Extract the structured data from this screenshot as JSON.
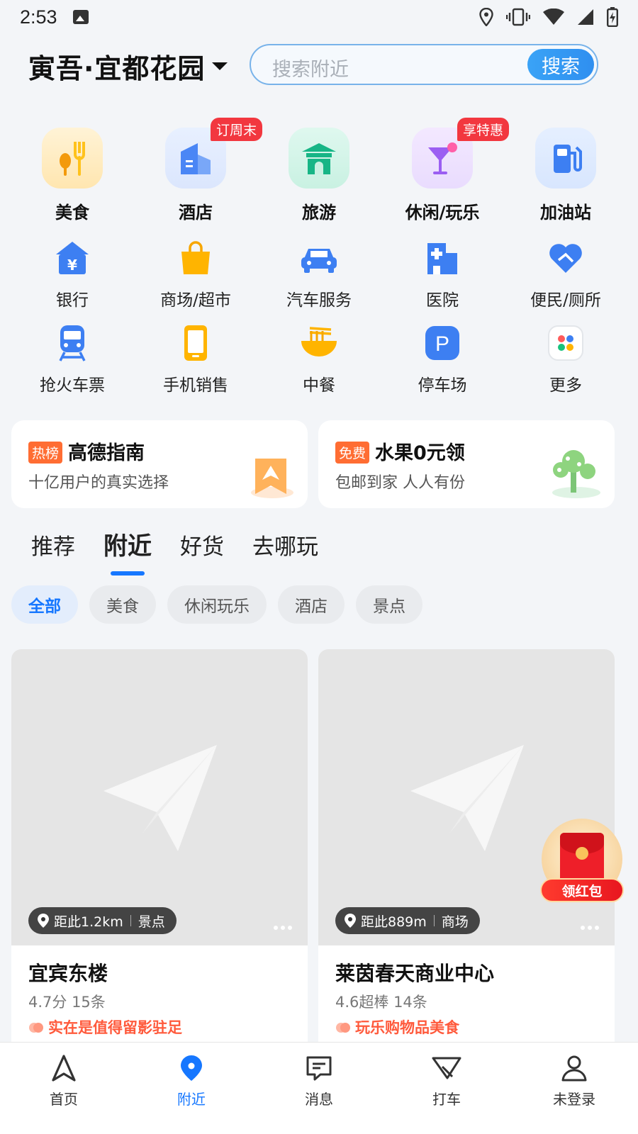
{
  "status_bar": {
    "time": "2:53"
  },
  "header": {
    "location": "寅吾·宜都花园",
    "search_placeholder": "搜索附近",
    "search_button": "搜索"
  },
  "main_categories": [
    {
      "label": "美食",
      "icon": "fork-spoon-icon"
    },
    {
      "label": "酒店",
      "icon": "hotel-building-icon",
      "badge": "订周末"
    },
    {
      "label": "旅游",
      "icon": "pavilion-icon"
    },
    {
      "label": "休闲/玩乐",
      "icon": "cocktail-icon",
      "badge": "享特惠"
    },
    {
      "label": "加油站",
      "icon": "gas-pump-icon"
    }
  ],
  "sub_categories_row1": [
    {
      "label": "银行",
      "icon": "bank-icon"
    },
    {
      "label": "商场/超市",
      "icon": "shopping-bag-icon"
    },
    {
      "label": "汽车服务",
      "icon": "car-icon"
    },
    {
      "label": "医院",
      "icon": "hospital-icon"
    },
    {
      "label": "便民/厕所",
      "icon": "heart-hand-icon"
    }
  ],
  "sub_categories_row2": [
    {
      "label": "抢火车票",
      "icon": "train-icon"
    },
    {
      "label": "手机销售",
      "icon": "phone-icon"
    },
    {
      "label": "中餐",
      "icon": "noodle-bowl-icon"
    },
    {
      "label": "停车场",
      "icon": "parking-icon"
    },
    {
      "label": "更多",
      "icon": "more-apps-icon"
    }
  ],
  "promos": [
    {
      "tag": "热榜",
      "title": "高德指南",
      "subtitle": "十亿用户的真实选择"
    },
    {
      "tag": "免费",
      "title": "水果0元领",
      "subtitle": "包邮到家 人人有份"
    }
  ],
  "tabs": [
    "推荐",
    "附近",
    "好货",
    "去哪玩"
  ],
  "active_tab": "附近",
  "filters": [
    "全部",
    "美食",
    "休闲玩乐",
    "酒店",
    "景点"
  ],
  "places": [
    {
      "distance": "距此1.2km",
      "type": "景点",
      "name": "宜宾东楼",
      "rating": "4.7分 15条",
      "highlight": "实在是值得留影驻足"
    },
    {
      "distance": "距此889m",
      "type": "商场",
      "name": "莱茵春天商业中心",
      "rating": "4.6超棒 14条",
      "highlight": "玩乐购物品美食"
    }
  ],
  "red_packet": "领红包",
  "bottom_nav": [
    "首页",
    "附近",
    "消息",
    "打车",
    "未登录"
  ],
  "colors": {
    "accent": "#1677ff",
    "badge": "#f2373f",
    "tag": "#ff6d33"
  }
}
